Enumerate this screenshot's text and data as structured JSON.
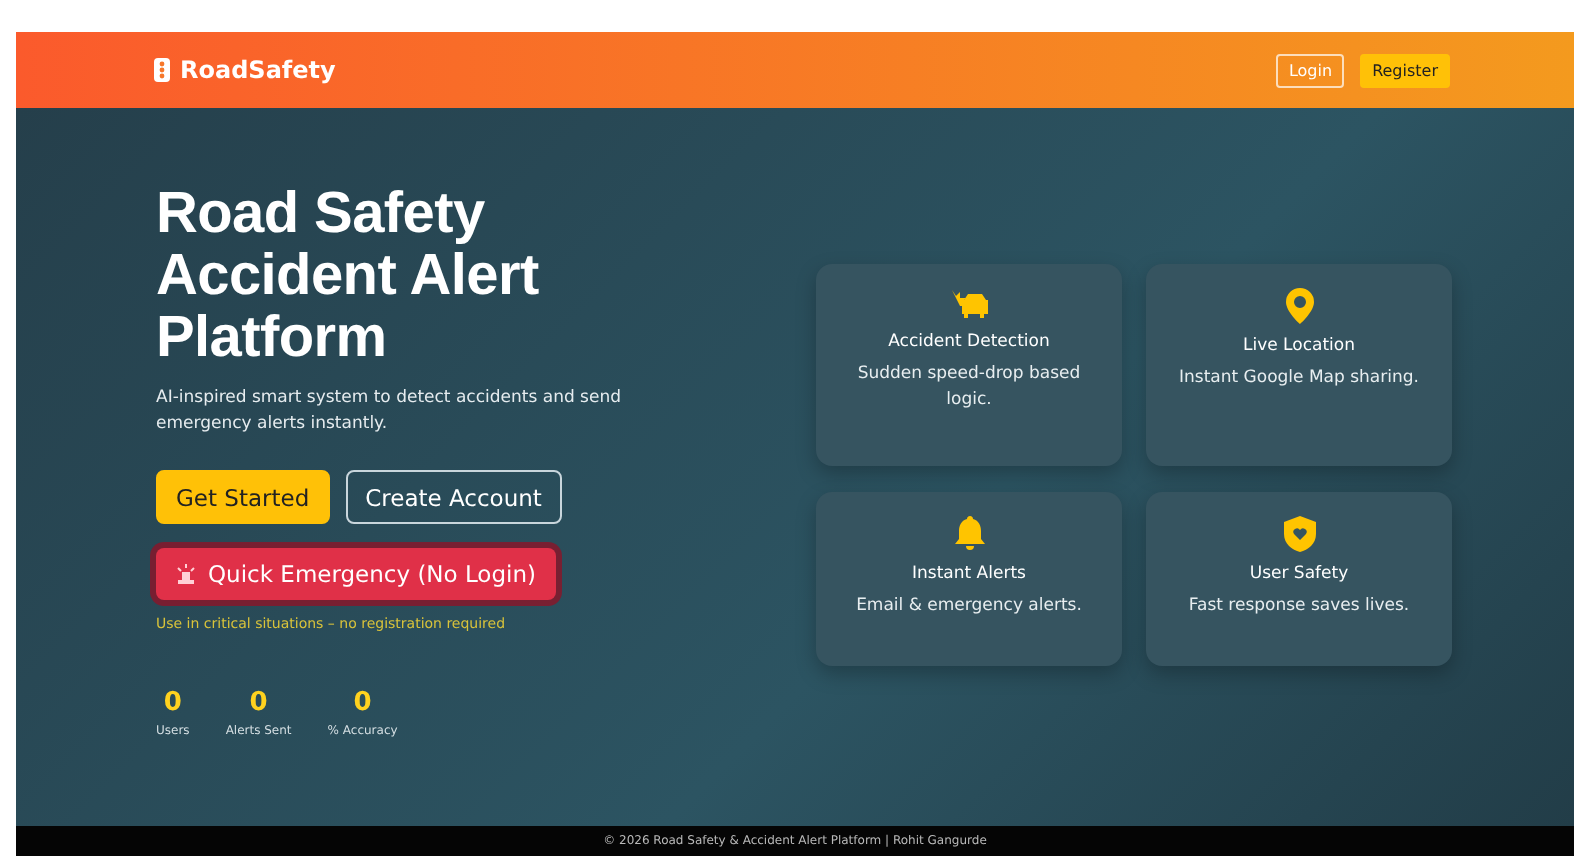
{
  "navbar": {
    "brand": "RoadSafety",
    "buttons": [
      {
        "label": "Login",
        "kind": "outline"
      },
      {
        "label": "Register",
        "kind": "solid"
      }
    ]
  },
  "hero": {
    "title_lines": [
      "Road Safety",
      "Accident Alert",
      "Platform"
    ],
    "subtitle": "AI-inspired smart system to detect accidents and send emergency alerts instantly.",
    "buttons": [
      {
        "label": "Get Started",
        "kind": "solid"
      },
      {
        "label": "Create Account",
        "kind": "outline"
      }
    ],
    "emergency": {
      "label": "Quick Emergency (No Login)",
      "note": "Use in critical situations – no registration required"
    },
    "stats": [
      {
        "value": "0",
        "label": "Users"
      },
      {
        "value": "0",
        "label": "Alerts Sent"
      },
      {
        "value": "0",
        "label": "% Accuracy"
      }
    ]
  },
  "features": [
    {
      "kind": "car",
      "title": "Accident Detection",
      "text": "Sudden speed-drop based logic."
    },
    {
      "kind": "pin",
      "title": "Live Location",
      "text": "Instant Google Map sharing."
    },
    {
      "kind": "bell",
      "title": "Instant Alerts",
      "text": "Email & emergency alerts."
    },
    {
      "kind": "shield",
      "title": "User Safety",
      "text": "Fast response saves lives."
    }
  ],
  "footer": {
    "text": "© 2026 Road Safety & Accident Alert Platform | Rohit Gangurde"
  }
}
